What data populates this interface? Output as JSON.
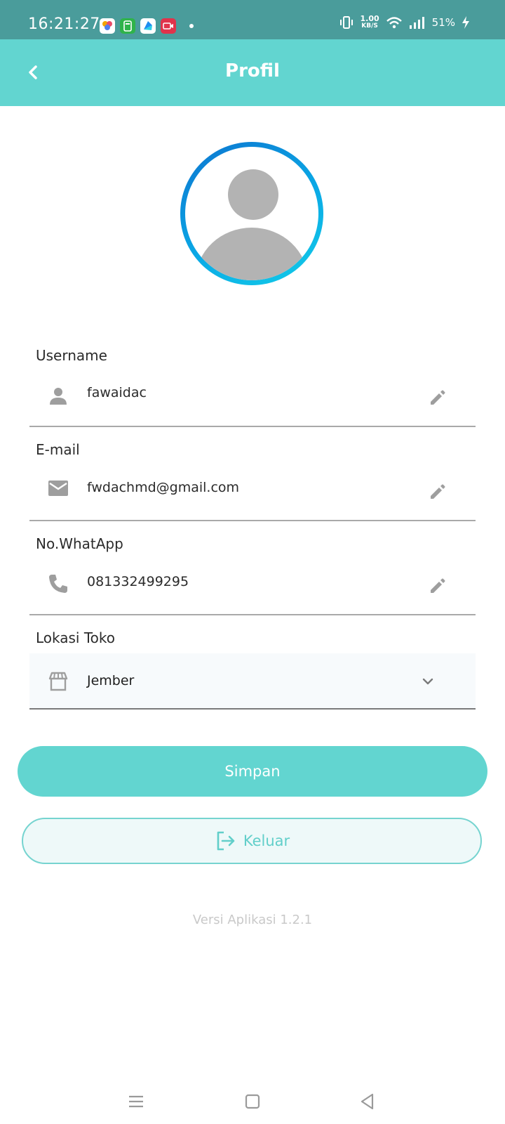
{
  "status_bar": {
    "time": "16:21:27",
    "net_speed_value": "1.00",
    "net_speed_unit": "KB/S",
    "battery": "51%",
    "app_icons": [
      "photos-icon",
      "calculator-icon",
      "browser-icon",
      "screen-recorder-icon"
    ]
  },
  "header": {
    "title": "Profil"
  },
  "fields": {
    "username": {
      "label": "Username",
      "value": "fawaidac"
    },
    "email": {
      "label": "E-mail",
      "value": "fwdachmd@gmail.com"
    },
    "whatsapp": {
      "label": "No.WhatApp",
      "value": "081332499295"
    },
    "store_location": {
      "label": "Lokasi Toko",
      "value": "Jember"
    }
  },
  "buttons": {
    "save": "Simpan",
    "logout": "Keluar"
  },
  "footer": {
    "version": "Versi Aplikasi 1.2.1"
  },
  "colors": {
    "status_bar": "#4a9c9b",
    "primary": "#62d5d0",
    "avatar_ring_start": "#0d74cf",
    "avatar_ring_end": "#13cde8",
    "icon_gray": "#9e9e9e"
  }
}
